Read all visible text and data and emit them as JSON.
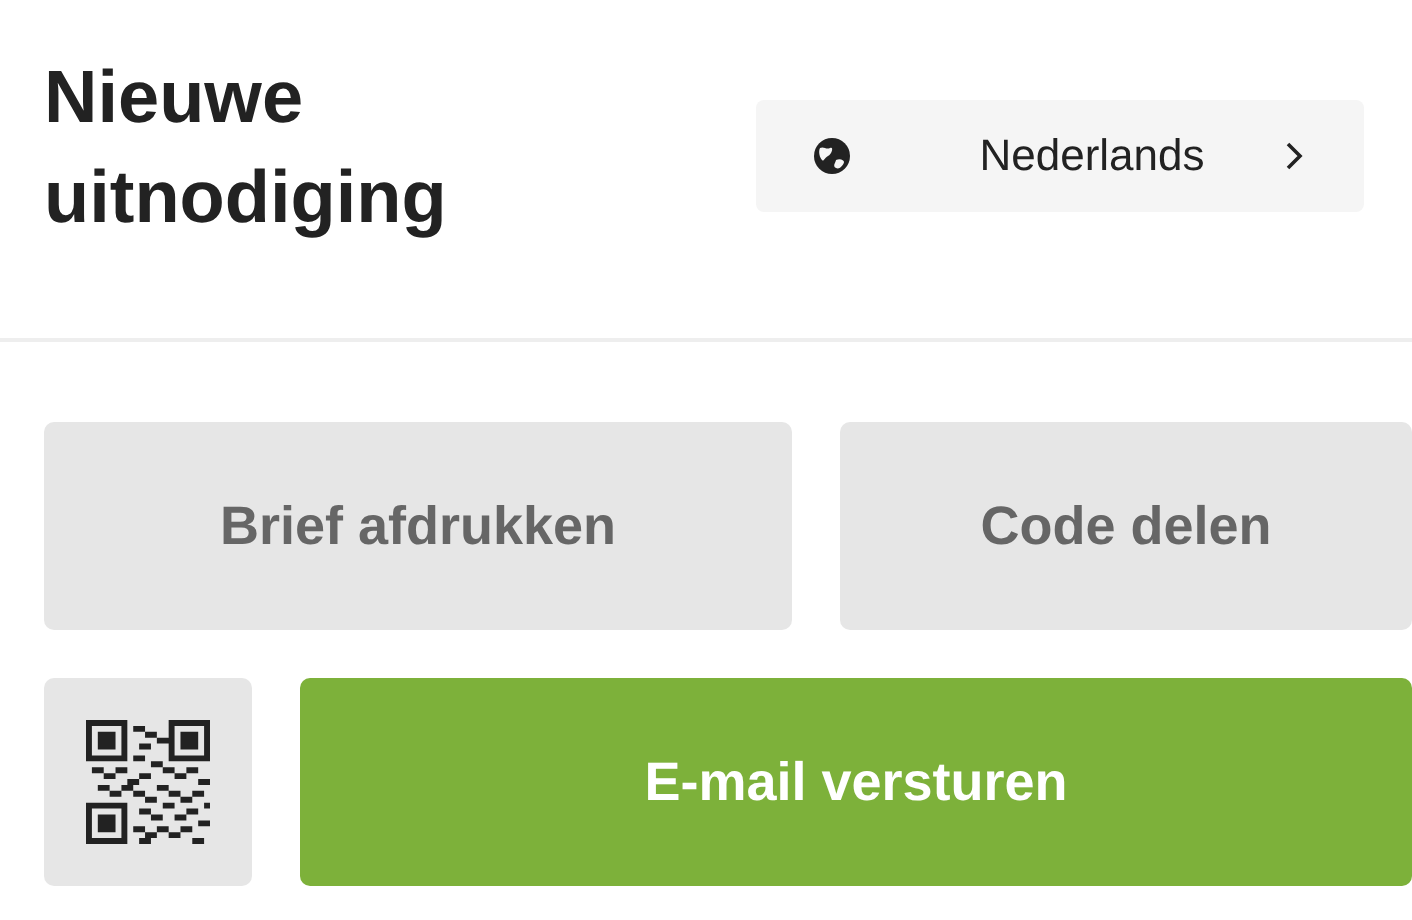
{
  "title": "Nieuwe uitnodiging",
  "language_button": {
    "label": "Nederlands"
  },
  "actions": [
    {
      "label": "Brief afdrukken",
      "kind": "secondary"
    },
    {
      "label": "Code delen",
      "kind": "secondary"
    },
    {
      "kind": "qr"
    },
    {
      "label": "E-mail versturen",
      "kind": "primary"
    }
  ]
}
